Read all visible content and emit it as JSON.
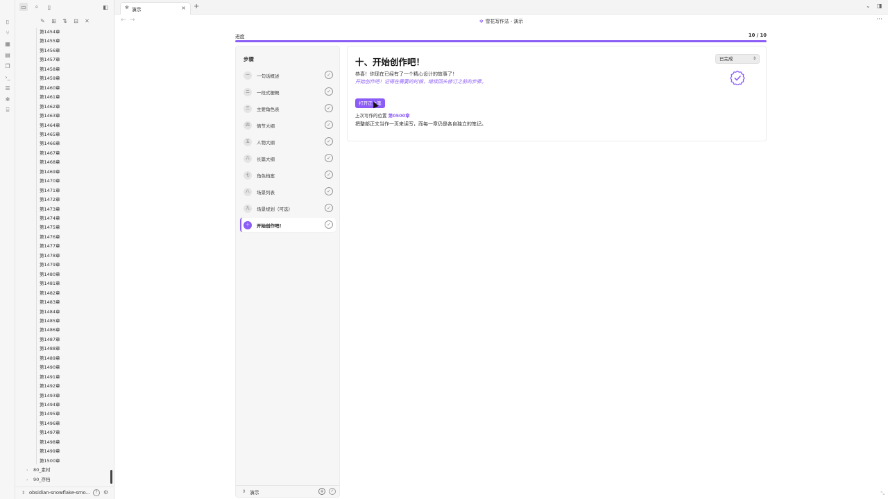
{
  "ribbon": [
    "file-icon",
    "graph-icon",
    "canvas-icon",
    "calendar-icon",
    "pages-icon",
    "terminal-icon",
    "list-icon",
    "snowflake-icon",
    "template-icon"
  ],
  "explorer": {
    "chapters": [
      "第1454章",
      "第1455章",
      "第1456章",
      "第1457章",
      "第1458章",
      "第1459章",
      "第1460章",
      "第1461章",
      "第1462章",
      "第1463章",
      "第1464章",
      "第1465章",
      "第1466章",
      "第1467章",
      "第1468章",
      "第1469章",
      "第1470章",
      "第1471章",
      "第1472章",
      "第1473章",
      "第1474章",
      "第1475章",
      "第1476章",
      "第1477章",
      "第1478章",
      "第1479章",
      "第1480章",
      "第1481章",
      "第1482章",
      "第1483章",
      "第1484章",
      "第1485章",
      "第1486章",
      "第1487章",
      "第1488章",
      "第1489章",
      "第1490章",
      "第1491章",
      "第1492章",
      "第1493章",
      "第1494章",
      "第1495章",
      "第1496章",
      "第1497章",
      "第1498章",
      "第1499章",
      "第1500章"
    ],
    "folders": [
      "80_素材",
      "90_存档"
    ],
    "vault_name": "obsidian-snowflake-smo..."
  },
  "tab": {
    "title": "演示"
  },
  "header": {
    "title": "雪花写作法 - 演示"
  },
  "progress": {
    "label": "进度",
    "count": "10 / 10",
    "fraction": 1.0
  },
  "steps": {
    "heading": "步骤",
    "items": [
      {
        "num": "一",
        "label": "一句话概述",
        "done": true
      },
      {
        "num": "二",
        "label": "一段式梗概",
        "done": true
      },
      {
        "num": "三",
        "label": "主要角色表",
        "done": true
      },
      {
        "num": "四",
        "label": "情节大纲",
        "done": true
      },
      {
        "num": "五",
        "label": "人物大纲",
        "done": true
      },
      {
        "num": "六",
        "label": "长篇大纲",
        "done": true
      },
      {
        "num": "七",
        "label": "角色档案",
        "done": true
      },
      {
        "num": "八",
        "label": "场景列表",
        "done": true
      },
      {
        "num": "九",
        "label": "场景规划（可选）",
        "done": true
      },
      {
        "num": "十",
        "label": "开始创作吧！",
        "done": true,
        "active": true
      }
    ],
    "footer_name": "演示"
  },
  "content": {
    "title": "十、开始创作吧！",
    "status": "已完成",
    "paragraph1": "恭喜！你现在已经有了一个精心设计的故事了！",
    "paragraph2": "开始创作吧！记得在需要的时候，继续回头修订之前的步骤。",
    "open_button": "打开正文笔",
    "last_position_label": "上次写作的位置",
    "last_position_link": "第0500章",
    "paragraph3": "把整部正文当作一页来读写，而每一章仍是各自独立的笔记。"
  },
  "colors": {
    "accent": "#8b5cf6"
  }
}
